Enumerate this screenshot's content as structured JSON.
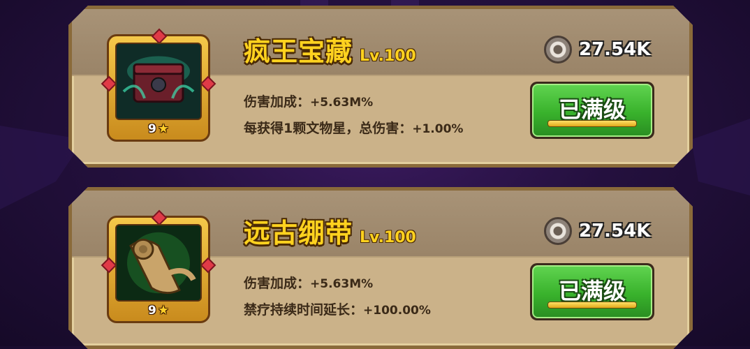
{
  "cards": [
    {
      "name": "疯王宝藏",
      "level": "Lv.100",
      "stars": "9",
      "cost": "27.54K",
      "stat1_label": "伤害加成：",
      "stat1_value": "+5.63M%",
      "stat2_label": "每获得1颗文物星，总伤害：",
      "stat2_value": "+1.00%",
      "button_label": "已满级",
      "icon": "treasure-chest-icon"
    },
    {
      "name": "远古绷带",
      "level": "Lv.100",
      "stars": "9",
      "cost": "27.54K",
      "stat1_label": "伤害加成：",
      "stat1_value": "+5.63M%",
      "stat2_label": "禁疗持续时间延长：",
      "stat2_value": "+100.00%",
      "button_label": "已满级",
      "icon": "ancient-scroll-icon"
    }
  ],
  "colors": {
    "title": "#ffd21f",
    "button_green": "#39b22c",
    "card_bg": "#cbb289",
    "background": "#24103e"
  }
}
